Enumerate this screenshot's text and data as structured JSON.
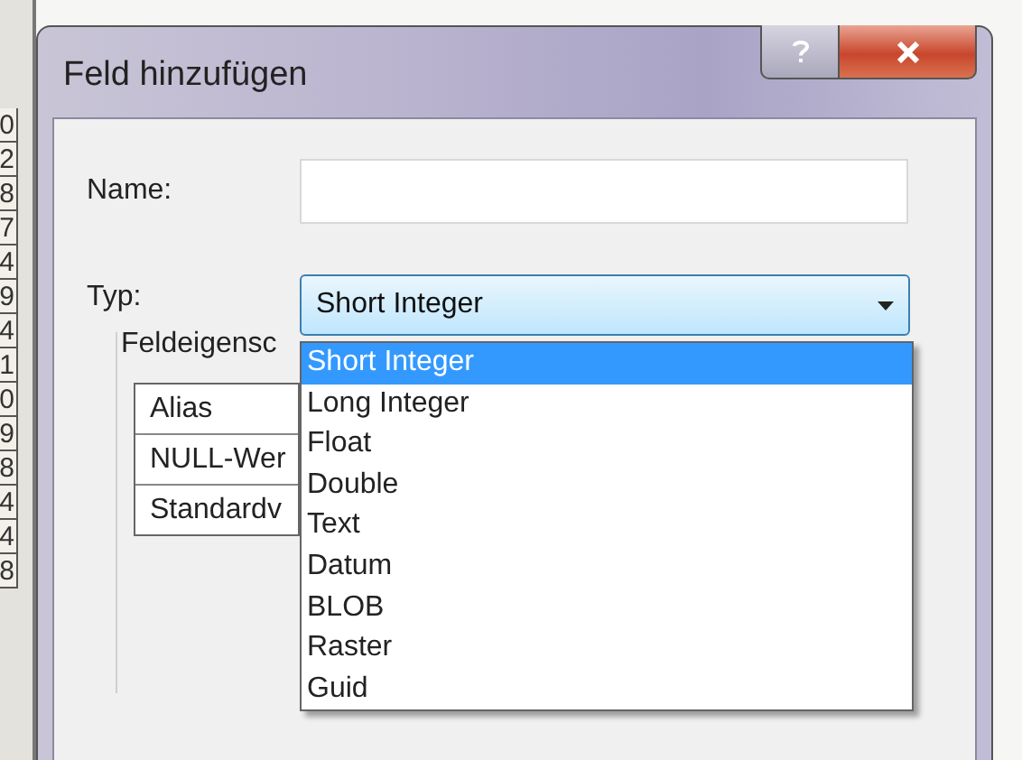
{
  "background": {
    "ruler_values": [
      "0",
      "2",
      "8",
      "7",
      "4",
      "9",
      "4",
      "1",
      "0",
      "9",
      "8",
      "4",
      "4",
      "8"
    ]
  },
  "window": {
    "title": "Feld hinzufügen"
  },
  "name_field": {
    "label": "Name:"
  },
  "type_field": {
    "label": "Typ:",
    "value": "Short Integer",
    "expanded": true,
    "options": [
      {
        "label": "Short Integer",
        "selected": true
      },
      {
        "label": "Long Integer",
        "selected": false
      },
      {
        "label": "Float",
        "selected": false
      },
      {
        "label": "Double",
        "selected": false
      },
      {
        "label": "Text",
        "selected": false
      },
      {
        "label": "Datum",
        "selected": false
      },
      {
        "label": "BLOB",
        "selected": false
      },
      {
        "label": "Raster",
        "selected": false
      },
      {
        "label": "Guid",
        "selected": false
      }
    ]
  },
  "field_properties": {
    "title": "Feldeigensc",
    "rows": [
      {
        "property": "Alias"
      },
      {
        "property": "NULL-Wer"
      },
      {
        "property": "Standardv"
      }
    ]
  }
}
